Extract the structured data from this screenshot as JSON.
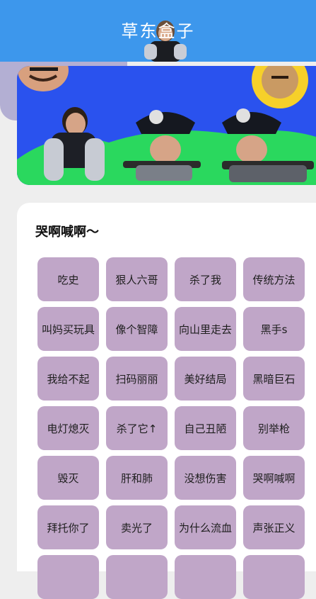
{
  "app": {
    "title": "草东盒子"
  },
  "theme": {
    "appbar": "#3d97ec",
    "button": "#c0a6c8",
    "banner_sky": "#2a52ee",
    "banner_grass": "#2ad85e"
  },
  "section": {
    "title": "哭啊喊啊～"
  },
  "buttons": [
    "吃史",
    "狠人六哥",
    "杀了我",
    "传统方法",
    "叫妈买玩具",
    "像个智障",
    "向山里走去",
    "黑手s",
    "我给不起",
    "扫码丽丽",
    "美好结局",
    "黑暗巨石",
    "电灯熄灭",
    "杀了它↑",
    "自己丑陋",
    "别举枪",
    "毁灭",
    "肝和肺",
    "没想伤害",
    "哭啊喊啊",
    "拜托你了",
    "卖光了",
    "为什么流血",
    "声张正义",
    "",
    "",
    "",
    ""
  ]
}
